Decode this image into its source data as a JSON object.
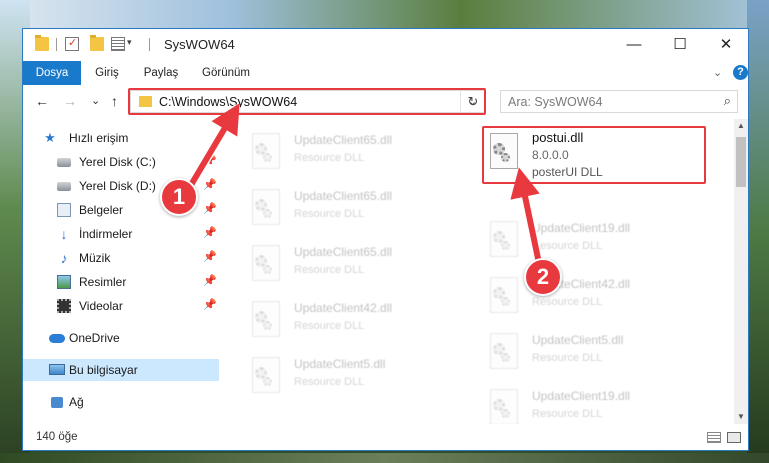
{
  "window": {
    "title": "SysWOW64",
    "minimize_glyph": "—",
    "maximize_glyph": "☐",
    "close_glyph": "✕"
  },
  "ribbon": {
    "tabs": [
      "Dosya",
      "Giriş",
      "Paylaş",
      "Görünüm"
    ],
    "collapse_glyph": "⌄",
    "help_glyph": "?"
  },
  "nav": {
    "back_glyph": "←",
    "forward_glyph": "→",
    "recent_glyph": "⌄",
    "up_glyph": "↑",
    "address": "C:\\Windows\\SysWOW64",
    "address_dropdown_glyph": "⌄",
    "refresh_glyph": "↻",
    "search_placeholder": "Ara: SysWOW64",
    "search_glyph": "⌕"
  },
  "sidebar": {
    "items": [
      {
        "label": "Hızlı erişim",
        "icon": "star-icon",
        "pinned": false
      },
      {
        "label": "Yerel Disk (C:)",
        "icon": "drive-icon",
        "pinned": true
      },
      {
        "label": "Yerel Disk (D:)",
        "icon": "drive-icon",
        "pinned": true
      },
      {
        "label": "Belgeler",
        "icon": "documents-icon",
        "pinned": true
      },
      {
        "label": "İndirmeler",
        "icon": "downloads-icon",
        "pinned": true
      },
      {
        "label": "Müzik",
        "icon": "music-icon",
        "pinned": true
      },
      {
        "label": "Resimler",
        "icon": "pictures-icon",
        "pinned": true
      },
      {
        "label": "Videolar",
        "icon": "videos-icon",
        "pinned": true
      },
      {
        "label": "OneDrive",
        "icon": "onedrive-icon",
        "pinned": false
      },
      {
        "label": "Bu bilgisayar",
        "icon": "this-pc-icon",
        "pinned": false,
        "selected": true
      },
      {
        "label": "Ağ",
        "icon": "network-icon",
        "pinned": false
      }
    ],
    "pin_glyph": "📌"
  },
  "files": {
    "left_column": [
      {
        "name": "UpdateClient65.dll",
        "type": "Resource DLL"
      },
      {
        "name": "UpdateClient65.dll",
        "type": "Resource DLL"
      },
      {
        "name": "UpdateClient65.dll",
        "type": "Resource DLL"
      },
      {
        "name": "UpdateClient42.dll",
        "type": "Resource DLL"
      },
      {
        "name": "UpdateClient5.dll",
        "type": "Resource DLL"
      }
    ],
    "right_column": [
      {
        "name": "UpdateClient19.dll",
        "type": "Resource DLL"
      },
      {
        "name": "UpdateClient42.dll",
        "type": "Resource DLL"
      },
      {
        "name": "UpdateClient5.dll",
        "type": "Resource DLL"
      },
      {
        "name": "UpdateClient19.dll",
        "type": "Resource DLL"
      }
    ],
    "highlighted": {
      "name": "postui.dll",
      "version": "8.0.0.0",
      "description": "posterUI DLL"
    }
  },
  "scrollbar": {
    "up_glyph": "▲",
    "down_glyph": "▼"
  },
  "status": {
    "item_count": "140 öğe"
  },
  "annotations": {
    "marker1": "1",
    "marker2": "2",
    "color": "#e8393f"
  }
}
